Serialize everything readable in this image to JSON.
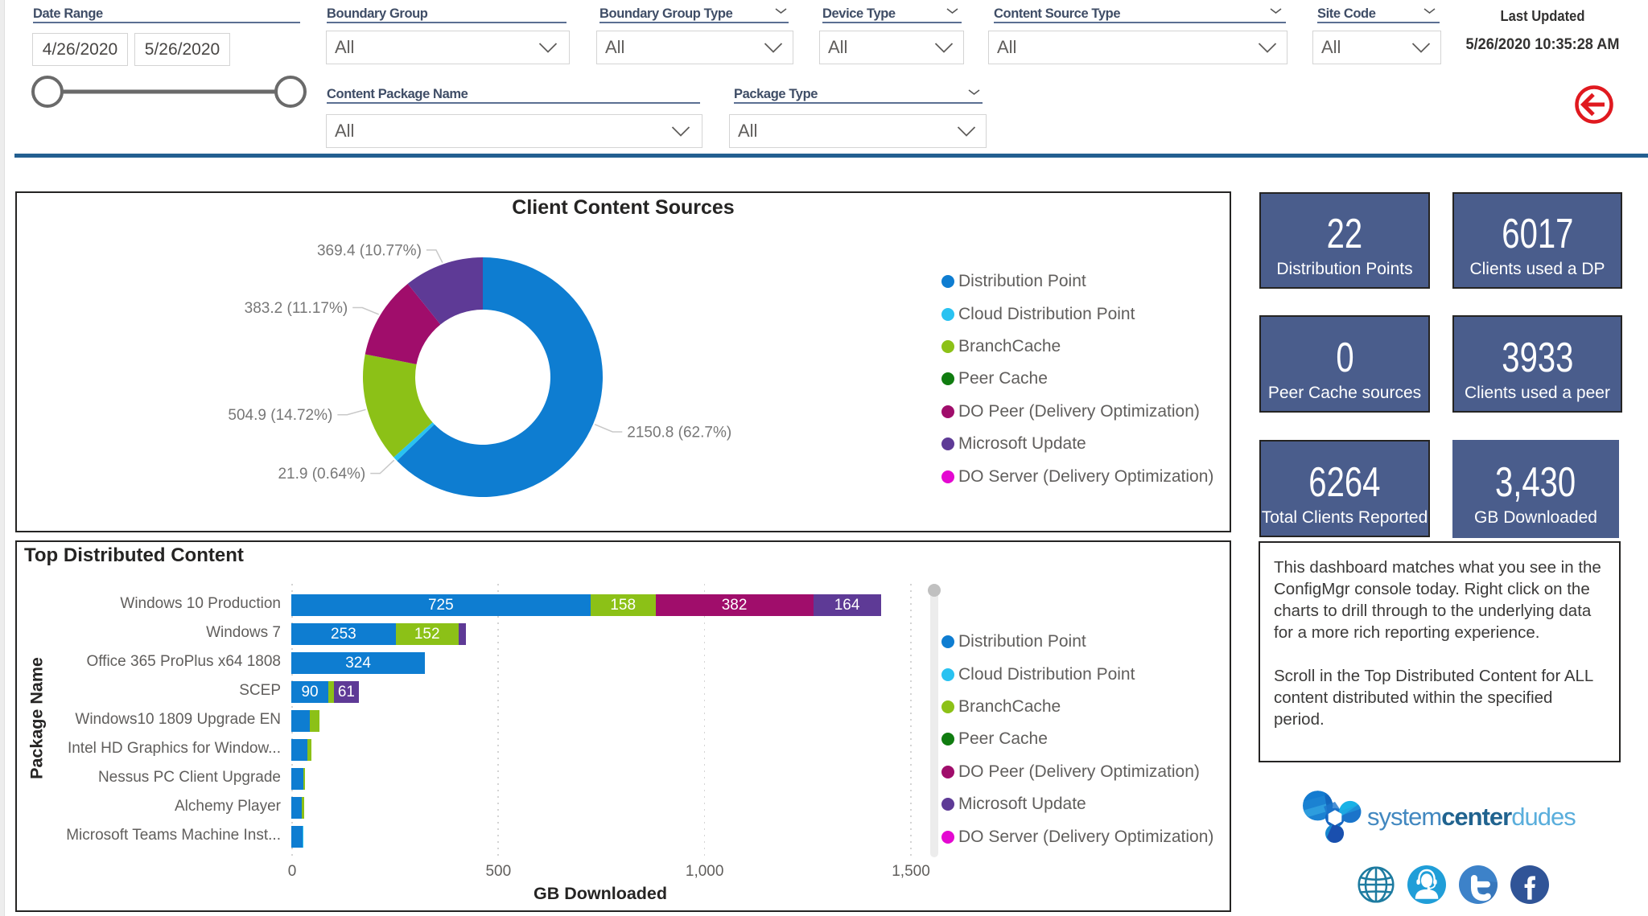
{
  "filters": {
    "date_range": {
      "label": "Date Range",
      "start": "4/26/2020",
      "end": "5/26/2020"
    },
    "boundary_group": {
      "label": "Boundary Group",
      "value": "All"
    },
    "boundary_group_type": {
      "label": "Boundary Group Type",
      "value": "All"
    },
    "device_type": {
      "label": "Device Type",
      "value": "All"
    },
    "content_source_type": {
      "label": "Content Source Type",
      "value": "All"
    },
    "site_code": {
      "label": "Site Code",
      "value": "All"
    },
    "content_package_name": {
      "label": "Content Package Name",
      "value": "All"
    },
    "package_type": {
      "label": "Package Type",
      "value": "All"
    },
    "last_updated": {
      "label": "Last Updated",
      "value": "5/26/2020 10:35:28 AM"
    }
  },
  "series_colors": {
    "Distribution Point": "#0e7dd1",
    "Cloud Distribution Point": "#29c2f1",
    "BranchCache": "#8cc117",
    "Peer Cache": "#107c10",
    "DO Peer (Delivery Optimization)": "#a00d6b",
    "Microsoft Update": "#5e3a96",
    "DO Server (Delivery Optimization)": "#e408d1"
  },
  "legend": [
    "Distribution Point",
    "Cloud Distribution Point",
    "BranchCache",
    "Peer Cache",
    "DO Peer (Delivery Optimization)",
    "Microsoft Update",
    "DO Server (Delivery Optimization)"
  ],
  "chart_data": [
    {
      "type": "pie",
      "title": "Client Content Sources",
      "legend_position": "right",
      "slices": [
        {
          "name": "Distribution Point",
          "value": 2150.8,
          "label": "2150.8 (62.7%)"
        },
        {
          "name": "Cloud Distribution Point",
          "value": 21.9,
          "label": "21.9 (0.64%)"
        },
        {
          "name": "BranchCache",
          "value": 504.9,
          "label": "504.9 (14.72%)"
        },
        {
          "name": "DO Peer (Delivery Optimization)",
          "value": 383.2,
          "label": "383.2 (11.17%)",
          "label_dy": 4
        },
        {
          "name": "Microsoft Update",
          "value": 369.4,
          "label": "369.4 (10.77%)",
          "label_dy": 7
        }
      ]
    },
    {
      "type": "bar",
      "title": "Top Distributed Content",
      "xlabel": "GB Downloaded",
      "ylabel": "Package Name",
      "xlim": [
        0,
        1500
      ],
      "xticks": [
        0,
        500,
        1000,
        1500
      ],
      "xtick_labels": [
        "0",
        "500",
        "1,000",
        "1,500"
      ],
      "legend_position": "right",
      "categories": [
        "Windows 10 Production",
        "Windows 7",
        "Office 365 ProPlus x64 1808",
        "SCEP",
        "Windows10 1809 Upgrade EN",
        "Intel HD Graphics for Window...",
        "Nessus PC Client Upgrade",
        "Alchemy Player",
        "Microsoft Teams Machine Inst..."
      ],
      "rows": [
        [
          [
            "Distribution Point",
            725
          ],
          [
            "BranchCache",
            158
          ],
          [
            "DO Peer (Delivery Optimization)",
            382
          ],
          [
            "Microsoft Update",
            164
          ]
        ],
        [
          [
            "Distribution Point",
            253
          ],
          [
            "BranchCache",
            152
          ],
          [
            "Microsoft Update",
            19
          ]
        ],
        [
          [
            "Distribution Point",
            324
          ]
        ],
        [
          [
            "Distribution Point",
            90
          ],
          [
            "BranchCache",
            13
          ],
          [
            "Microsoft Update",
            61
          ]
        ],
        [
          [
            "Distribution Point",
            45
          ],
          [
            "BranchCache",
            23
          ]
        ],
        [
          [
            "Distribution Point",
            39
          ],
          [
            "BranchCache",
            10
          ]
        ],
        [
          [
            "Distribution Point",
            29
          ],
          [
            "BranchCache",
            4
          ]
        ],
        [
          [
            "Distribution Point",
            25
          ],
          [
            "BranchCache",
            6
          ]
        ],
        [
          [
            "Distribution Point",
            27
          ],
          [
            "Cloud Distribution Point",
            3
          ]
        ]
      ]
    }
  ],
  "kpis": [
    {
      "value": "22",
      "label": "Distribution Points"
    },
    {
      "value": "6017",
      "label": "Clients used a DP"
    },
    {
      "value": "0",
      "label": "Peer Cache sources"
    },
    {
      "value": "3933",
      "label": "Clients used a peer"
    },
    {
      "value": "6264",
      "label": "Total Clients Reported"
    },
    {
      "value": "3,430",
      "label": "GB Downloaded"
    }
  ],
  "note": {
    "p1": "This dashboard matches what you see in the ConfigMgr console today. Right click on the charts to drill through to the underlying data for a more rich reporting experience.",
    "p2": "Scroll in the Top Distributed Content for ALL content distributed within the specified period."
  },
  "logo": {
    "word1": "system",
    "word2": "center",
    "word3": "dudes"
  },
  "accent_colors": {
    "divider": "#235f90",
    "kpi_bg": "#4a5d8c",
    "back_button": "#e0191f"
  }
}
